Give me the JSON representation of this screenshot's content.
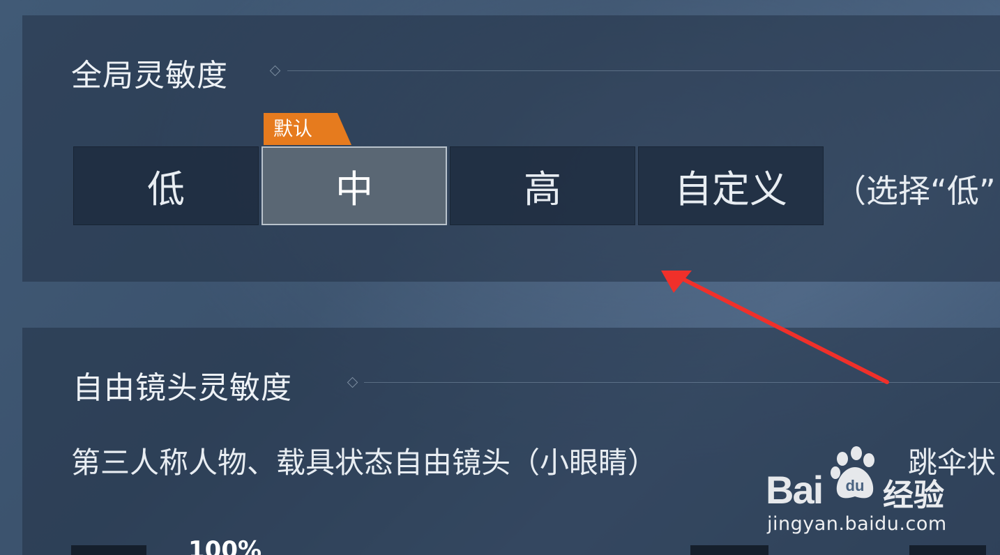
{
  "global_sensitivity": {
    "title": "全局灵敏度",
    "default_tag": "默认",
    "options": [
      "低",
      "中",
      "高",
      "自定义"
    ],
    "selected": "中",
    "hint": "（选择“低”"
  },
  "free_camera_sensitivity": {
    "title": "自由镜头灵敏度",
    "left_label": "第三人称人物、载具状态自由镜头（小眼睛）",
    "right_label": "跳伞状",
    "value_percent": "100%"
  },
  "annotation": {
    "arrow_color": "#f0302a"
  },
  "watermark": {
    "brand": "Bai",
    "brand_suffix": "du",
    "product": "经验",
    "url": "jingyan.baidu.com"
  },
  "colors": {
    "tag_orange": "#e67b1e",
    "selected_border": "#b9c3cc"
  }
}
